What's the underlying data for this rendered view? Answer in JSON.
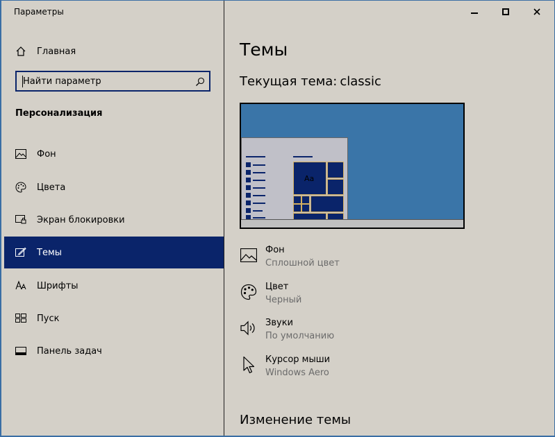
{
  "window": {
    "title": "Параметры",
    "minimize_label": "–",
    "maximize_label": "□",
    "close_label": "✕"
  },
  "sidebar": {
    "home_label": "Главная",
    "search_placeholder": "Найти параметр",
    "section_title": "Персонализация",
    "items": [
      {
        "label": "Фон",
        "icon": "picture-icon",
        "active": false
      },
      {
        "label": "Цвета",
        "icon": "palette-icon",
        "active": false
      },
      {
        "label": "Экран блокировки",
        "icon": "lock-screen-icon",
        "active": false
      },
      {
        "label": "Темы",
        "icon": "themes-icon",
        "active": true
      },
      {
        "label": "Шрифты",
        "icon": "fonts-icon",
        "active": false
      },
      {
        "label": "Пуск",
        "icon": "start-icon",
        "active": false
      },
      {
        "label": "Панель задач",
        "icon": "taskbar-icon",
        "active": false
      }
    ]
  },
  "main": {
    "title": "Темы",
    "current_theme_label": "Текущая тема:",
    "current_theme_value": "classic",
    "preview_tile_text": "Aa",
    "properties": [
      {
        "title": "Фон",
        "subtitle": "Сплошной цвет",
        "icon": "picture-icon"
      },
      {
        "title": "Цвет",
        "subtitle": "Черный",
        "icon": "palette-icon"
      },
      {
        "title": "Звуки",
        "subtitle": "По умолчанию",
        "icon": "speaker-icon"
      },
      {
        "title": "Курсор мыши",
        "subtitle": "Windows Aero",
        "icon": "cursor-icon"
      }
    ],
    "change_theme_title": "Изменение темы"
  },
  "colors": {
    "accent": "#0a246a",
    "surface": "#d4d0c8",
    "desktop": "#3a6ea5"
  }
}
